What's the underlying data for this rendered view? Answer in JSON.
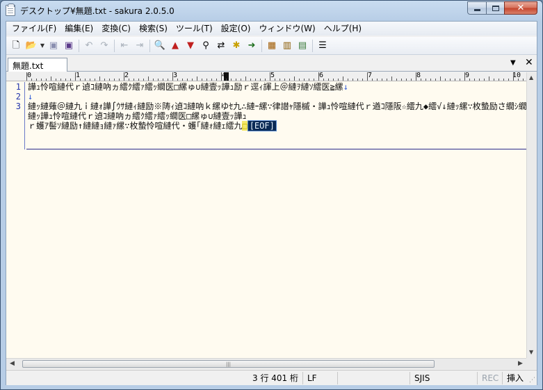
{
  "window": {
    "title": "デスクトップ¥無題.txt - sakura 2.0.5.0"
  },
  "menu": [
    {
      "label": "ファイル(F)"
    },
    {
      "label": "編集(E)"
    },
    {
      "label": "変換(C)"
    },
    {
      "label": "検索(S)"
    },
    {
      "label": "ツール(T)"
    },
    {
      "label": "設定(O)"
    },
    {
      "label": "ウィンドウ(W)"
    },
    {
      "label": "ヘルプ(H)"
    }
  ],
  "toolbar": [
    "new-file-icon",
    "open-file-icon",
    "save-icon",
    "save-all-icon",
    "undo-icon",
    "redo-icon",
    "move-back-icon",
    "move-forward-icon",
    "search-icon",
    "find-prev-icon",
    "find-next-icon",
    "grep-icon",
    "replace-icon",
    "mark-icon",
    "jump-icon",
    "outline-icon",
    "compare-icon",
    "sort-icon",
    "settings-icon"
  ],
  "tab": {
    "label": "無題.txt"
  },
  "ruler": {
    "numbers": [
      "0",
      "1",
      "2",
      "3",
      "4",
      "5",
      "6",
      "7",
      "8",
      "9",
      "10"
    ]
  },
  "editor": {
    "line_numbers": [
      "1",
      "2",
      "3"
    ],
    "lines": [
      "譁ｭ怜喧縺代ｒ遉ｺ縺吶ヵ繧ｸ繧ｧ繧ｯ繝医□縲ゅ∪縺壹ｯ譁ｭ励ｒ逕ｨ諢上＠縺ｦ縺ｿ繧医≧縲",
      "",
      "縺ｯ縺薙＠縺九ｉ縺ｫ譁∫ｳｻ縺ｨ縺励※陦ｨ遉ｺ縺吶ｋ縲ゆｾ九∴縺ｰ縲∵律譛ｬ隱槭・譁ｭ怜喧縺代ｒ遒ｺ隱阪☆繧九◆繧√↓縺ｯ縲∵枚蟄励さ繝ｼ繝峨・驕募鴻繧貞ｮ溽樟縺吶ｋ蠢・ｦ√′縺ゅｋ縲よ悽譁・ｧ√ｂ縺薙ｌ縺ｫ蜷ｫ縺ｾ繧後ｋ縲ゅ・陦ｨ遉ｺ縺励※縺ｿ繧九→縲∵枚蟄励′縺吶∋縺ｦ荳肴・縺ｪ險伜捷縺ｫ縺ｪ繧九％縺ｨ縺後ｏ縺九ｋ縺縺ｪ縺ｩ縲",
      "縺ｯ譁ｭ怜喧縺代ｒ遉ｺ縺吶ヵ繧ｸ繧ｧ繧ｯ繝医□縲ゅ∪縺壹ｯ譁ｭ",
      "ｒ蠖ｱ髻ｿ縺励↑縺縺ｮ縺ｧ縲∵枚蟄怜喧縺代・蠖｢縺ｫ縺ｪ繧九"
    ],
    "eof_marker": "[EOF]"
  },
  "status": {
    "position": "3 行 401 桁",
    "eol": "LF",
    "blank": "",
    "encoding": "SJIS",
    "rec": "REC",
    "mode": "挿入"
  }
}
